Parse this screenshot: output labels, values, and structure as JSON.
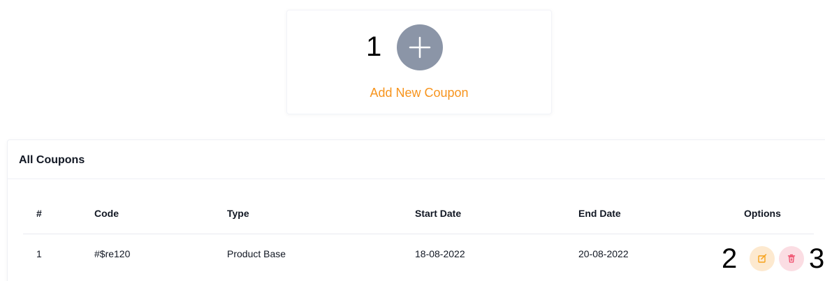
{
  "add_card": {
    "marker": "1",
    "add_icon": "plus-icon",
    "label": "Add New Coupon"
  },
  "coupons": {
    "title": "All Coupons",
    "columns": [
      "#",
      "Code",
      "Type",
      "Start Date",
      "End Date",
      "Options"
    ],
    "rows": [
      {
        "index": "1",
        "code": "#$re120",
        "type": "Product Base",
        "start_date": "18-08-2022",
        "end_date": "20-08-2022"
      }
    ],
    "edit_marker": "2",
    "delete_marker": "3",
    "edit_icon": "edit-icon",
    "delete_icon": "trash-icon"
  },
  "colors": {
    "accent_orange": "#f7941d",
    "add_button": "#8b95a7",
    "edit_bg": "#fde9cf",
    "edit_icon": "#f7a21b",
    "delete_bg": "#fbdde3",
    "delete_icon": "#ef4d6b"
  }
}
